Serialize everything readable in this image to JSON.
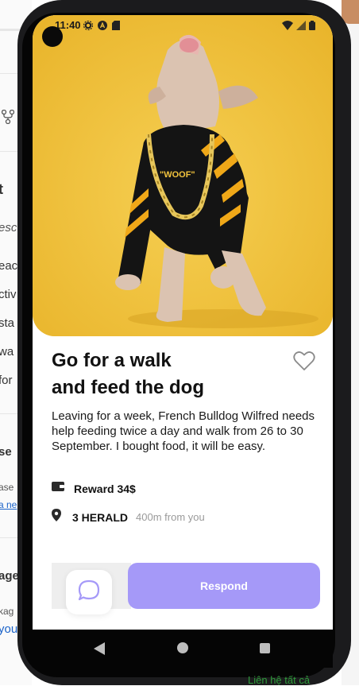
{
  "status_bar": {
    "time": "11:40",
    "left_icons": [
      "gear-icon",
      "a-badge-icon",
      "sd-card-icon"
    ],
    "right_icons": [
      "wifi-icon",
      "signal-icon",
      "battery-icon"
    ]
  },
  "task": {
    "title_line1": "Go for a walk",
    "title_line2": "and feed the dog",
    "description": "Leaving for a week, French Bulldog Wilfred needs help feeding twice a day and walk from 26 to 30 September. I bought food, it will be easy.",
    "reward_label": "Reward 34$",
    "location_label": "3 HERALD",
    "distance_label": "400m from you",
    "favorited": false
  },
  "actions": {
    "respond_label": "Respond"
  },
  "background_page": {
    "snippets": [
      "t",
      "esc",
      "eac",
      "ctiv",
      "sta",
      "wa",
      "for",
      "se",
      "ase",
      "a ne",
      "age",
      "kag",
      "you"
    ],
    "bottom_link": "Liên hệ tất cả"
  },
  "colors": {
    "photo_background": "#f2c33d",
    "accent": "#a599f8",
    "text_primary": "#111111",
    "text_muted": "#9a9a9a"
  },
  "photo": {
    "subject": "French bulldog wearing black hoodie with gold chain",
    "hoodie_text": "\"WOOF\""
  }
}
